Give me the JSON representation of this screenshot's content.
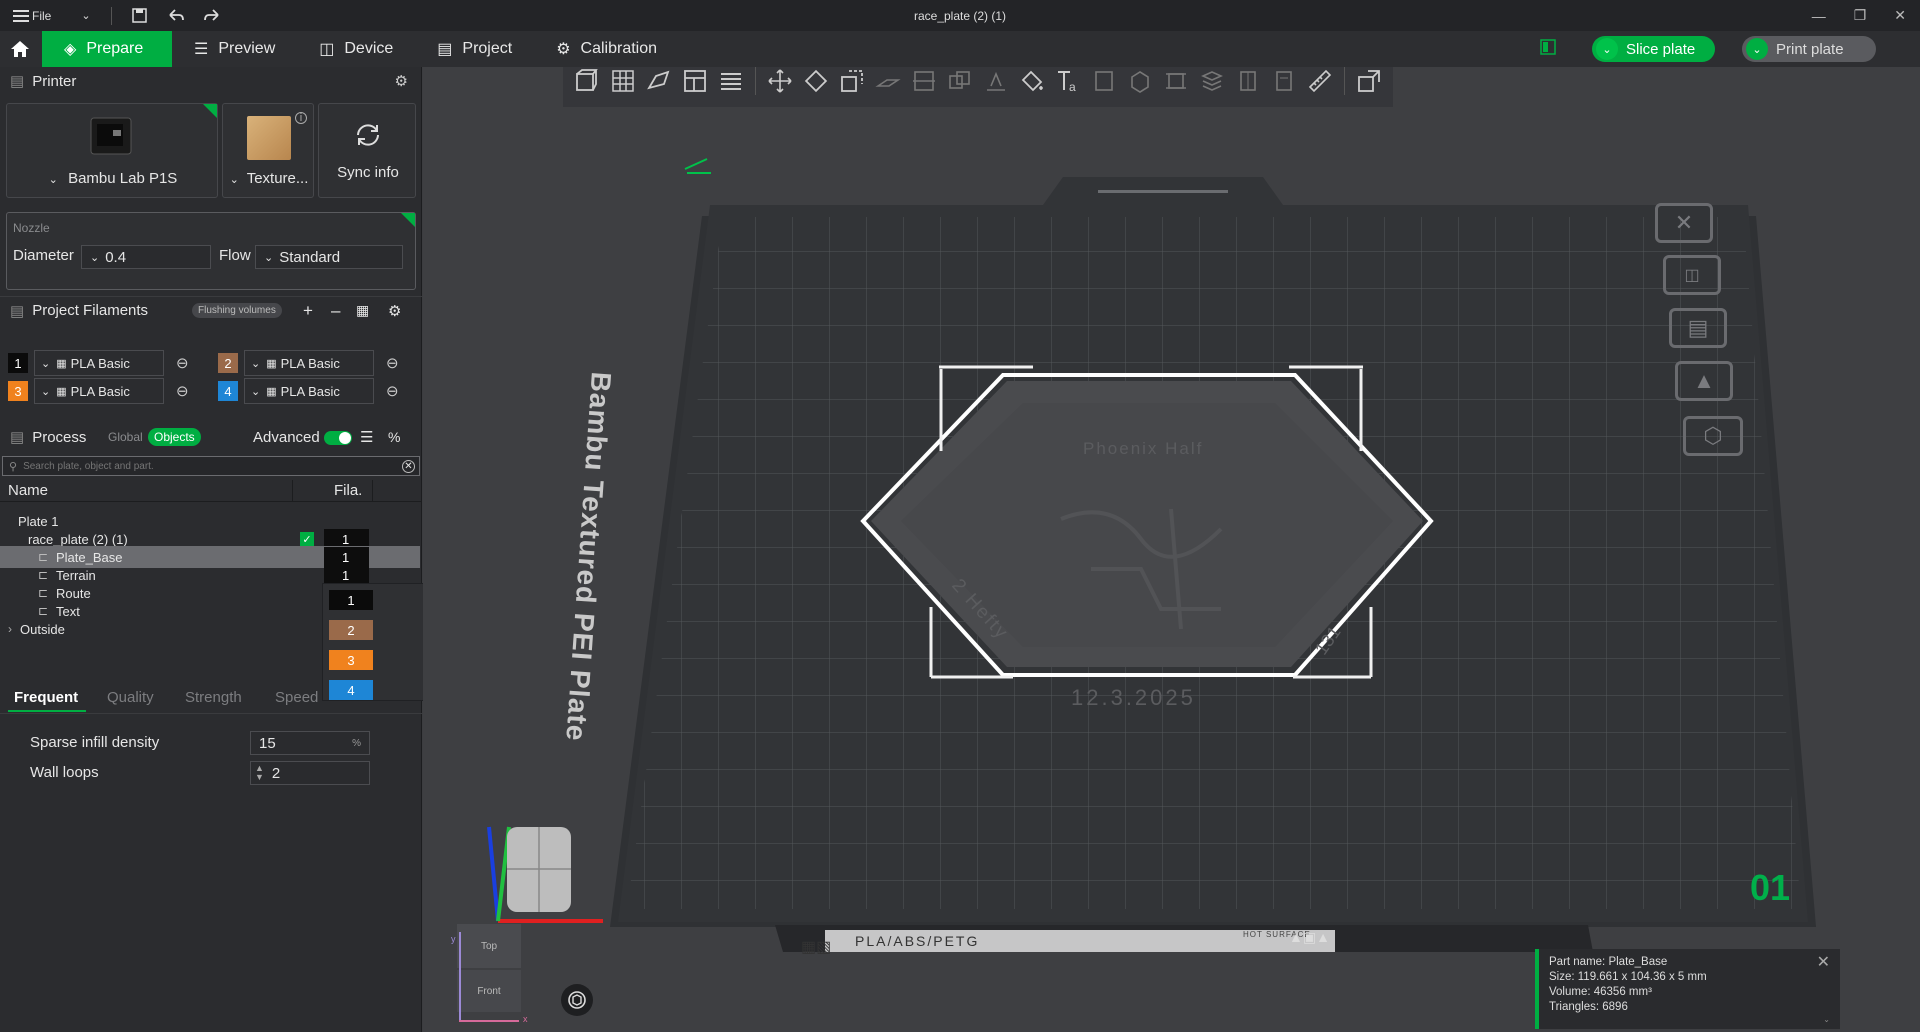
{
  "titlebar": {
    "file_label": "File",
    "window_title": "race_plate (2) (1)"
  },
  "tabs": {
    "prepare": "Prepare",
    "preview": "Preview",
    "device": "Device",
    "project": "Project",
    "calibration": "Calibration"
  },
  "actions": {
    "slice_plate": "Slice plate",
    "print_plate": "Print plate"
  },
  "printer": {
    "section_title": "Printer",
    "printer_name": "Bambu Lab P1S",
    "plate_type": "Texture...",
    "sync_label": "Sync info"
  },
  "nozzle": {
    "section_label": "Nozzle",
    "diameter_label": "Diameter",
    "diameter_value": "0.4",
    "flow_label": "Flow",
    "flow_value": "Standard"
  },
  "filaments": {
    "section_title": "Project Filaments",
    "flushing_label": "Flushing volumes",
    "items": [
      {
        "num": "1",
        "name": "PLA Basic",
        "color": "#0b0b0b"
      },
      {
        "num": "2",
        "name": "PLA Basic",
        "color": "#9a6a4a"
      },
      {
        "num": "3",
        "name": "PLA Basic",
        "color": "#f0821e"
      },
      {
        "num": "4",
        "name": "PLA Basic",
        "color": "#1e86d6"
      }
    ]
  },
  "process": {
    "section_title": "Process",
    "global_label": "Global",
    "objects_label": "Objects",
    "advanced_label": "Advanced",
    "search_placeholder": "Search plate, object and part.",
    "col_name": "Name",
    "col_fila": "Fila.",
    "tree": [
      {
        "label": "Plate 1"
      },
      {
        "label": "race_plate (2) (1)",
        "fila": "1"
      },
      {
        "label": "Plate_Base",
        "fila": "1"
      },
      {
        "label": "Terrain",
        "fila": "1"
      },
      {
        "label": "Route"
      },
      {
        "label": "Text"
      },
      {
        "label": "Outside"
      }
    ],
    "fila_dropdown": [
      "1",
      "2",
      "3",
      "4"
    ],
    "subtabs": [
      "Frequent",
      "Quality",
      "Strength",
      "Speed"
    ],
    "settings": [
      {
        "label": "Sparse infill density",
        "value": "15",
        "unit": "%"
      },
      {
        "label": "Wall loops",
        "value": "2"
      }
    ]
  },
  "plate": {
    "bed_label": "Bambu Textured PEI Plate",
    "plate_number": "01",
    "bed_footer": "PLA/ABS/PETG",
    "hot_surface": "HOT SURFACE",
    "model_texts": [
      "Phoenix Half",
      "2 Hefty",
      "12.3.2025",
      "131"
    ]
  },
  "view_cube": {
    "top_label": "Top",
    "front_label": "Front",
    "axis_x": "x",
    "axis_y": "y"
  },
  "part_info": {
    "name": "Part name: Plate_Base",
    "size": "Size: 119.661 x 104.36 x 5 mm",
    "volume": "Volume: 46356 mm³",
    "triangles": "Triangles: 6896"
  },
  "colors": {
    "accent": "#00ae42",
    "panel_bg": "#2b2c2f",
    "viewport_bg": "#3e3f42"
  }
}
